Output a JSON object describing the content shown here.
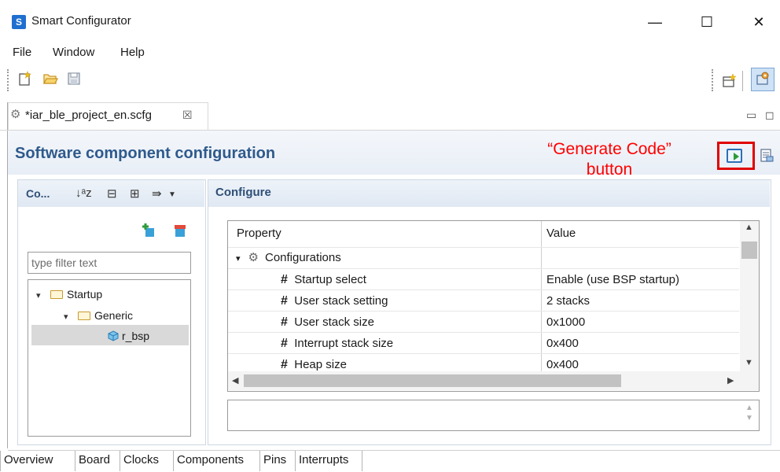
{
  "window": {
    "title": "Smart Configurator",
    "icon_letter": "S",
    "minimize": "—",
    "maximize": "☐",
    "close": "✕"
  },
  "menu": [
    "File",
    "Window",
    "Help"
  ],
  "editor_tab": {
    "label": "*iar_ble_project_en.scfg",
    "close": "☒"
  },
  "header": {
    "title": "Software component configuration"
  },
  "annotation": {
    "line1": "“Generate Code”",
    "line2": "button",
    "color": "#ff0000"
  },
  "left_panel": {
    "title": "Co...",
    "filter_placeholder": "type filter text",
    "tree": [
      {
        "label": "Startup",
        "level": 0,
        "expanded": true
      },
      {
        "label": "Generic",
        "level": 1,
        "expanded": true
      },
      {
        "label": "r_bsp",
        "level": 2,
        "selected": true
      }
    ]
  },
  "right_panel": {
    "title": "Configure",
    "columns": [
      "Property",
      "Value"
    ],
    "group": "Configurations",
    "rows": [
      {
        "property": "Startup select",
        "value": "Enable (use BSP startup)"
      },
      {
        "property": "User stack setting",
        "value": "2 stacks"
      },
      {
        "property": "User stack size",
        "value": "0x1000"
      },
      {
        "property": "Interrupt stack size",
        "value": "0x400"
      },
      {
        "property": "Heap size",
        "value": "0x400"
      }
    ]
  },
  "bottom_tabs": [
    "Overview",
    "Board",
    "Clocks",
    "Components",
    "Pins",
    "Interrupts"
  ],
  "colors": {
    "header_title": "#2f5a8c",
    "panel_title": "#2f4f76",
    "accent_red": "#e00000"
  }
}
